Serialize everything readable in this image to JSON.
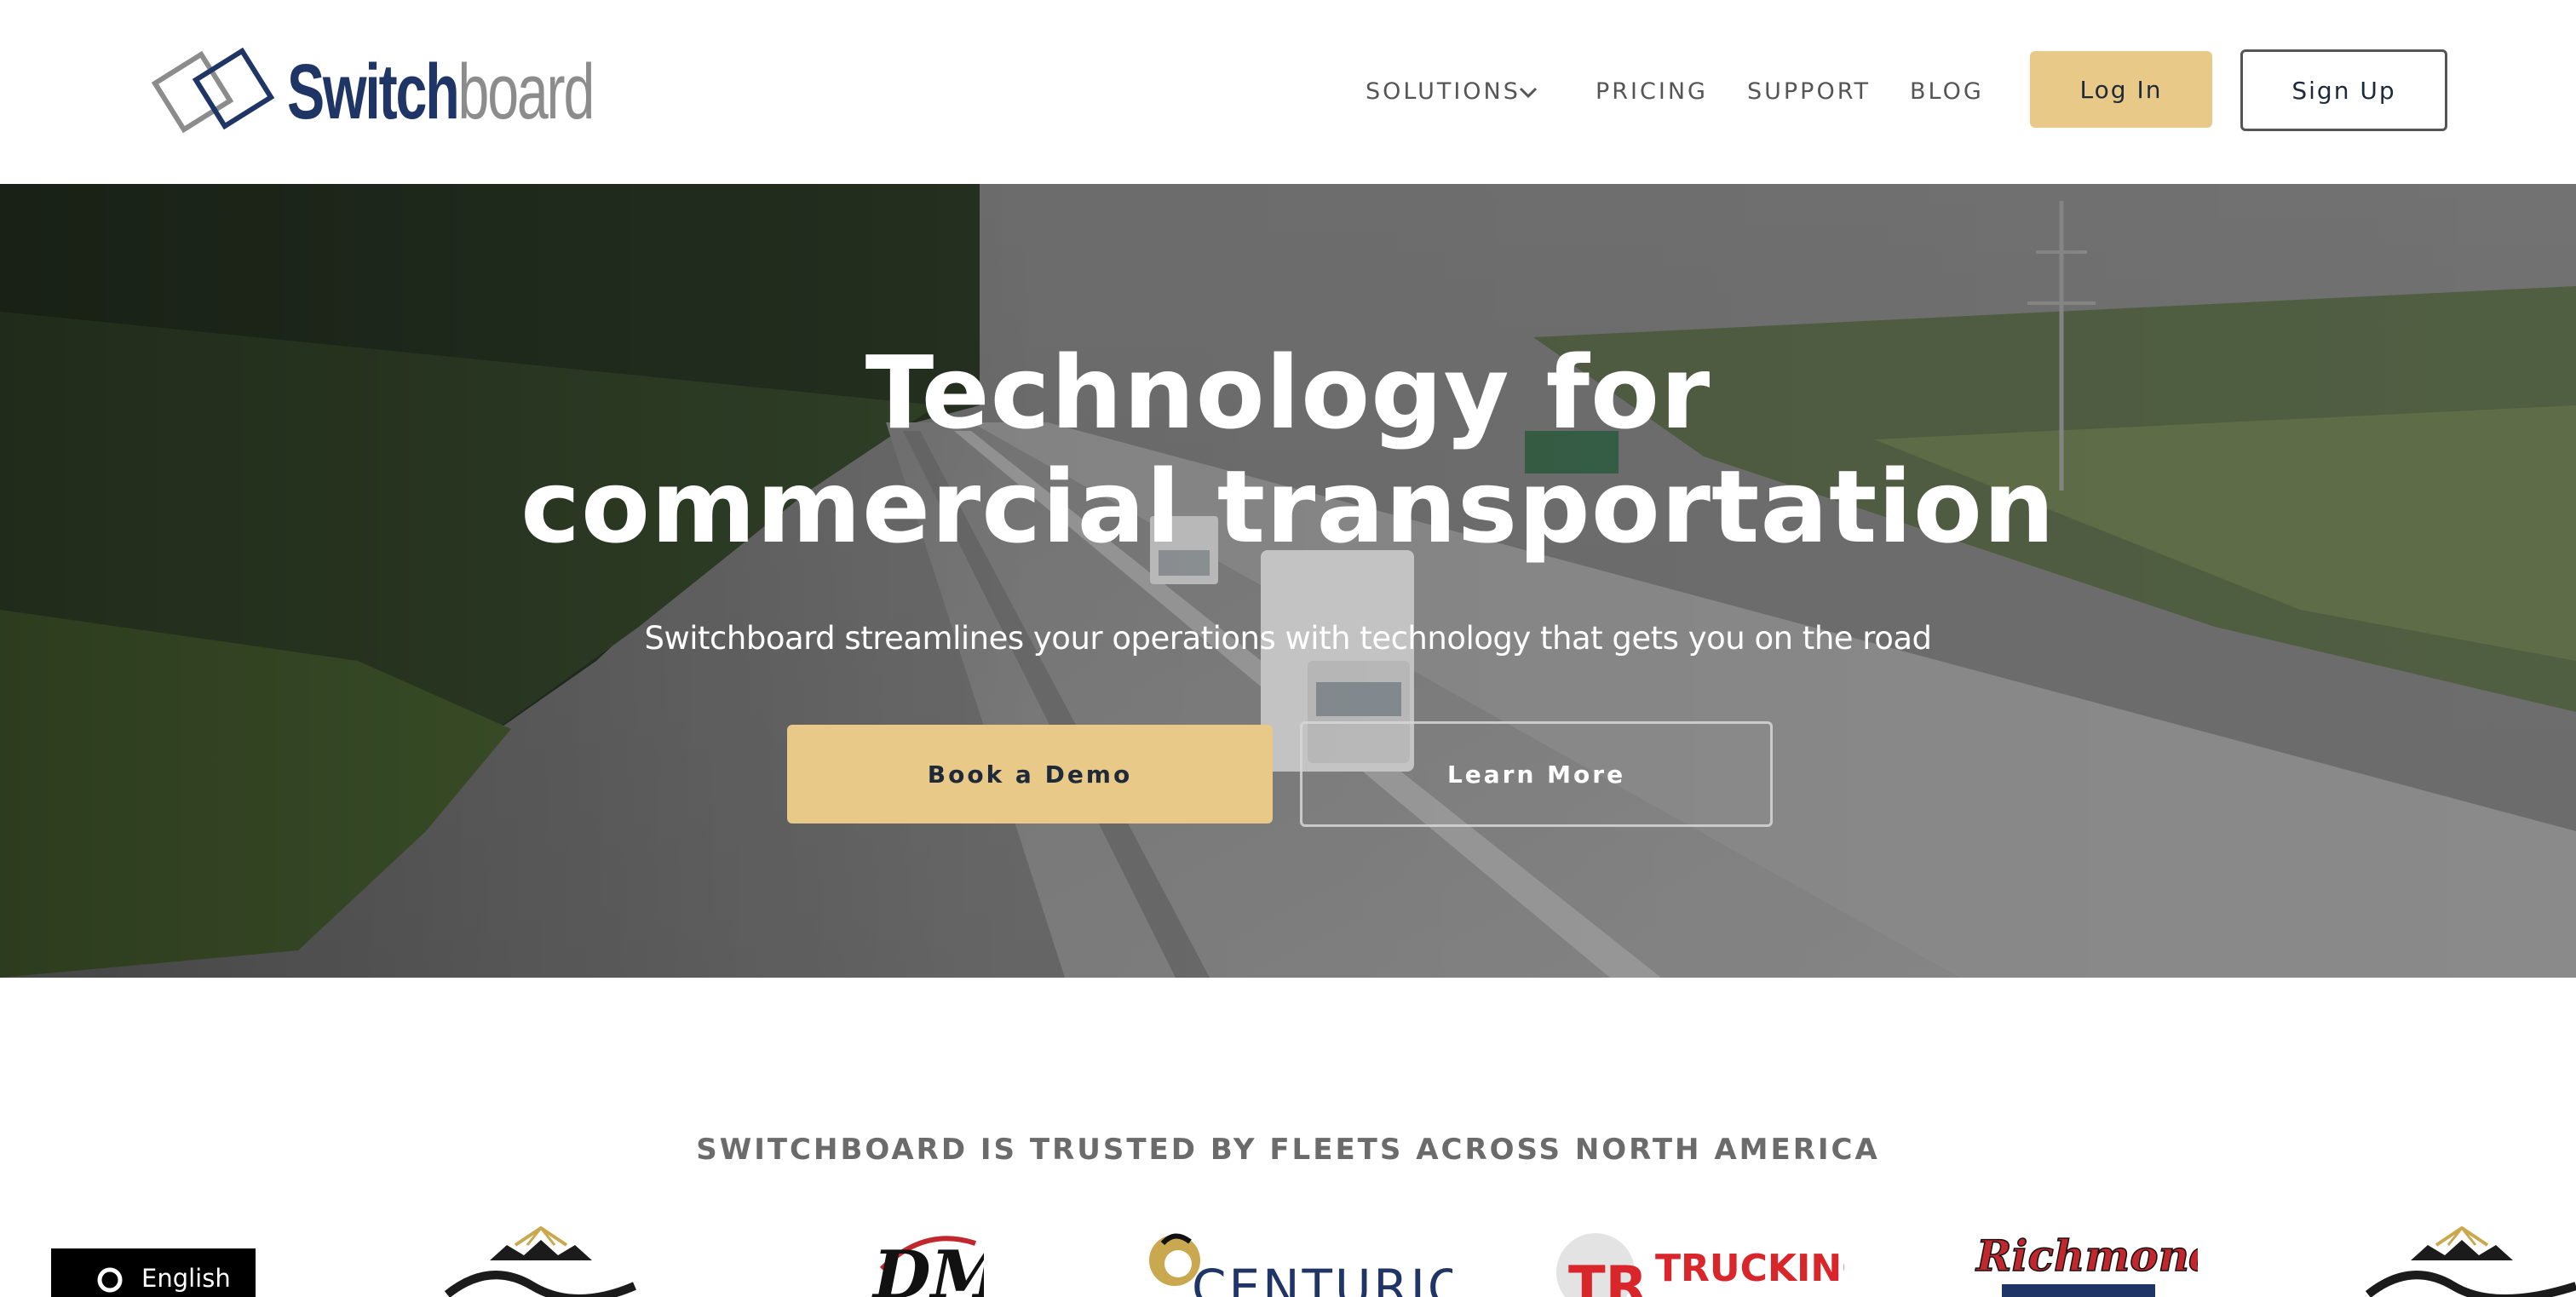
{
  "header": {
    "logo": {
      "word_bold": "Switch",
      "word_light": "board"
    },
    "nav": {
      "solutions": "SOLUTIONS",
      "pricing": "PRICING",
      "support": "SUPPORT",
      "blog": "BLOG"
    },
    "login_label": "Log In",
    "signup_label": "Sign Up"
  },
  "hero": {
    "title_line1": "Technology for",
    "title_line2": "commercial transportation",
    "subtitle": "Switchboard streamlines your operations with technology that gets you on the road",
    "demo_button": "Book a Demo",
    "learn_button": "Learn More"
  },
  "trusted": {
    "heading": "SWITCHBOARD IS TRUSTED BY FLEETS ACROSS NORTH AMERICA",
    "logos": [
      "Sunshine-Coast",
      "DM",
      "CENTURION",
      "TRUCKING",
      "Richmond",
      "Sunshine-Coast"
    ],
    "logo_texts": {
      "dm": "DM",
      "centurion": "CENTURION",
      "trucking": "TRUCKING",
      "richmond": "Richmond"
    }
  },
  "language": {
    "label": "English"
  },
  "colors": {
    "brand_navy": "#1f3566",
    "brand_gray": "#8c8c8c",
    "accent_gold": "#e8c988",
    "trucking_red": "#d8262b"
  }
}
